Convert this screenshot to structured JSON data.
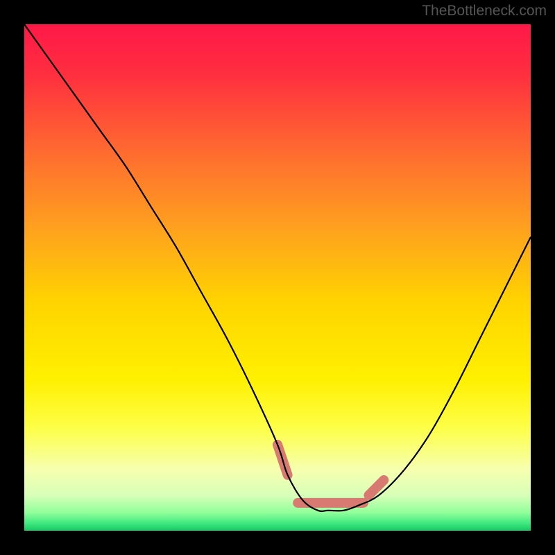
{
  "watermark": "TheBottleneck.com",
  "chart_data": {
    "type": "line",
    "title": "",
    "xlabel": "",
    "ylabel": "",
    "xlim": [
      0,
      100
    ],
    "ylim": [
      0,
      100
    ],
    "background_gradient": {
      "stops": [
        {
          "offset": 0.0,
          "color": "#ff1848"
        },
        {
          "offset": 0.1,
          "color": "#ff2f3f"
        },
        {
          "offset": 0.25,
          "color": "#ff6a30"
        },
        {
          "offset": 0.4,
          "color": "#ffa01f"
        },
        {
          "offset": 0.55,
          "color": "#ffd400"
        },
        {
          "offset": 0.7,
          "color": "#fff000"
        },
        {
          "offset": 0.8,
          "color": "#fdff4a"
        },
        {
          "offset": 0.88,
          "color": "#f6ffb0"
        },
        {
          "offset": 0.93,
          "color": "#d8ffb8"
        },
        {
          "offset": 0.965,
          "color": "#8fff9a"
        },
        {
          "offset": 0.985,
          "color": "#40e880"
        },
        {
          "offset": 1.0,
          "color": "#18c964"
        }
      ]
    },
    "curve": {
      "x": [
        0,
        5,
        10,
        15,
        20,
        25,
        30,
        35,
        40,
        45,
        50,
        52,
        55,
        58,
        60,
        63,
        66,
        70,
        75,
        80,
        85,
        90,
        95,
        100
      ],
      "y": [
        100,
        93,
        86,
        79,
        72,
        64,
        56,
        47,
        38,
        28,
        17,
        11,
        6,
        4,
        4,
        4,
        5,
        7,
        12,
        19,
        28,
        38,
        48,
        58
      ]
    },
    "highlight_band": {
      "color": "#d97a72",
      "segments": [
        {
          "x": [
            50,
            52
          ],
          "y": [
            17,
            11
          ]
        },
        {
          "x": [
            54,
            67
          ],
          "y": [
            5.5,
            5.5
          ]
        },
        {
          "x": [
            68,
            71
          ],
          "y": [
            7,
            10
          ]
        }
      ]
    }
  }
}
